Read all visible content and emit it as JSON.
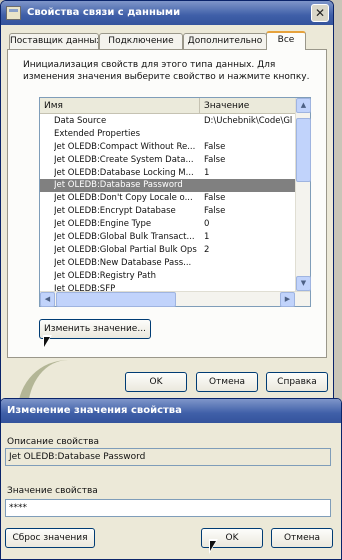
{
  "window1": {
    "title": "Свойства связи с данными",
    "close_glyph": "✕",
    "tabs": [
      "Поставщик данных",
      "Подключение",
      "Дополнительно",
      "Все"
    ],
    "hint": "Инициализация свойств для этого типа данных. Для изменения значения выберите свойство и нажмите кнопку.",
    "list": {
      "col_name": "Имя",
      "col_value": "Значение",
      "rows": [
        {
          "name": "Data Source",
          "value": "D:\\Uchebnik\\Code\\Gl"
        },
        {
          "name": "Extended Properties",
          "value": ""
        },
        {
          "name": "Jet OLEDB:Compact Without Re...",
          "value": "False"
        },
        {
          "name": "Jet OLEDB:Create System Data...",
          "value": "False"
        },
        {
          "name": "Jet OLEDB:Database Locking M...",
          "value": "1"
        },
        {
          "name": "Jet OLEDB:Database Password",
          "value": ""
        },
        {
          "name": "Jet OLEDB:Don't Copy Locale o...",
          "value": "False"
        },
        {
          "name": "Jet OLEDB:Encrypt Database",
          "value": "False"
        },
        {
          "name": "Jet OLEDB:Engine Type",
          "value": "0"
        },
        {
          "name": "Jet OLEDB:Global Bulk Transact...",
          "value": "1"
        },
        {
          "name": "Jet OLEDB:Global Partial Bulk Ops",
          "value": "2"
        },
        {
          "name": "Jet OLEDB:New Database Pass...",
          "value": ""
        },
        {
          "name": "Jet OLEDB:Registry Path",
          "value": ""
        },
        {
          "name": "Jet OLEDB:SFP",
          "value": ""
        }
      ],
      "selected_index": 5
    },
    "edit_button": "Изменить значение...",
    "ok": "OK",
    "cancel": "Отмена",
    "help": "Справка"
  },
  "window2": {
    "title": "Изменение значения свойства",
    "desc_label": "Описание свойства",
    "desc_value": "Jet OLEDB:Database Password",
    "value_label": "Значение свойства",
    "value_value": "****",
    "reset": "Сброс значения",
    "ok": "OK",
    "cancel": "Отмена"
  }
}
